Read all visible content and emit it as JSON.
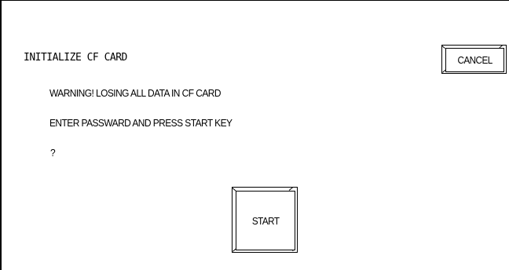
{
  "screen": {
    "title": "INITIALIZE CF CARD",
    "warning": "WARNING! LOSING ALL DATA IN CF CARD",
    "instruction": "ENTER PASSWARD AND PRESS START KEY",
    "prompt": "?"
  },
  "buttons": {
    "cancel_label": "CANCEL",
    "start_label": "START"
  },
  "colors": {
    "background": "#ffffff",
    "foreground": "#000000"
  }
}
